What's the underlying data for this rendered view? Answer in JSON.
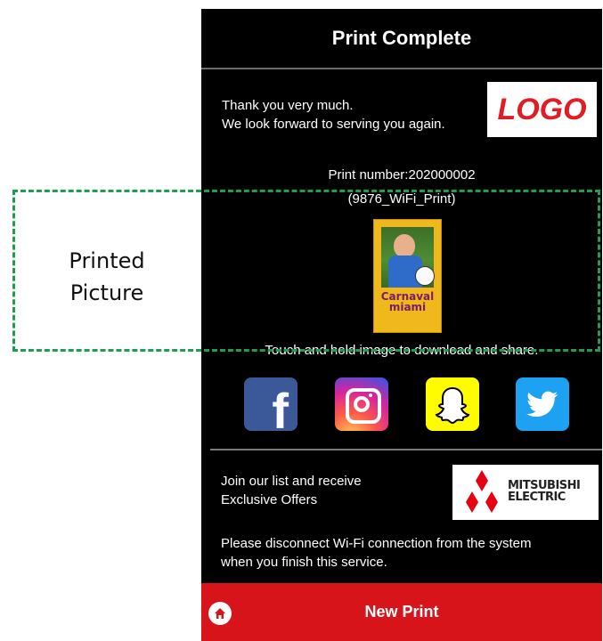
{
  "annotation": {
    "label_line1": "Printed",
    "label_line2": "Picture",
    "frame_color": "#1e9e52"
  },
  "screen": {
    "title": "Print Complete",
    "thanks_line1": "Thank you very much.",
    "thanks_line2": "We look forward to serving you again.",
    "logo_text": "LOGO",
    "print_number": "Print number:202000002",
    "print_source": "(9876_WiFi_Print)",
    "photo_text_line1": "Carnaval",
    "photo_text_line2": "miami",
    "touch_hint": "Touch and hold image to download and share.",
    "socials": [
      {
        "name": "facebook",
        "icon": "facebook-icon",
        "glyph": "f"
      },
      {
        "name": "instagram",
        "icon": "instagram-icon"
      },
      {
        "name": "snapchat",
        "icon": "snapchat-icon"
      },
      {
        "name": "twitter",
        "icon": "twitter-icon"
      }
    ],
    "join_line1": "Join our list and receive",
    "join_line2": "Exclusive Offers",
    "mitsubishi_line1": "MITSUBISHI",
    "mitsubishi_line2": "ELECTRIC",
    "disconnect_line1": "Please disconnect Wi-Fi connection from the system",
    "disconnect_line2": "when you finish this service.",
    "new_print_label": "New Print"
  },
  "colors": {
    "background": "#000000",
    "accent_red": "#d8141b",
    "logo_red": "#e01c24"
  }
}
